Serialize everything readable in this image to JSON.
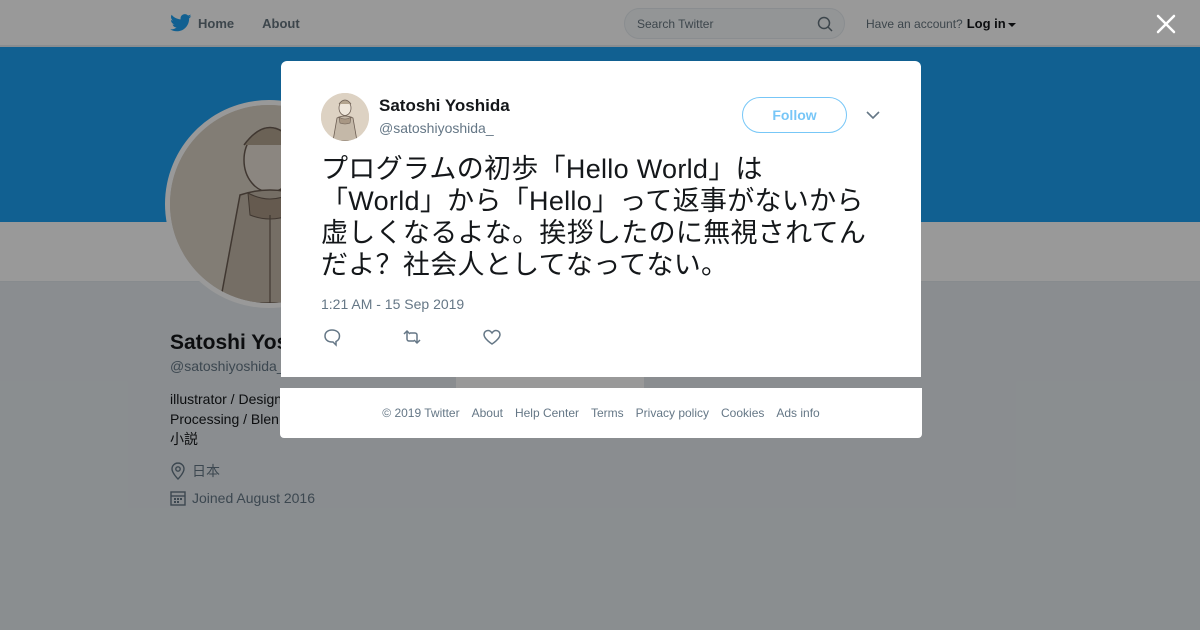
{
  "nav": {
    "home_label": "Home",
    "about_label": "About",
    "search_placeholder": "Search Twitter",
    "account_prompt": "Have an account?",
    "login_label": "Log in"
  },
  "profile": {
    "name": "Satoshi Yoshida",
    "handle": "@satoshiyoshida_",
    "bio_lines": [
      "illustrator / Design",
      "Processing / Blen",
      "小説"
    ],
    "location": "日本",
    "joined": "Joined August 2016"
  },
  "tweet": {
    "author_name": "Satoshi Yoshida",
    "author_handle": "@satoshiyoshida_",
    "follow_label": "Follow",
    "text_lines": [
      "プログラムの初歩「Hello World」は",
      "「World」から「Hello」って返事がないから",
      "虚しくなるよな。挨拶したのに無視されてん",
      "だよ？社会人としてなってない。"
    ],
    "timestamp": "1:21 AM - 15 Sep 2019"
  },
  "footer": {
    "links": [
      "© 2019 Twitter",
      "About",
      "Help Center",
      "Terms",
      "Privacy policy",
      "Cookies",
      "Ads info"
    ]
  },
  "colors": {
    "accent": "#1da1f2",
    "secondary_text": "#657786"
  },
  "icons": {
    "logo": "twitter-bird-icon",
    "search": "search-icon",
    "close": "close-icon",
    "chevron": "chevron-down-icon",
    "reply": "reply-icon",
    "retweet": "retweet-icon",
    "like": "heart-icon",
    "location": "location-pin-icon",
    "calendar": "calendar-icon"
  }
}
